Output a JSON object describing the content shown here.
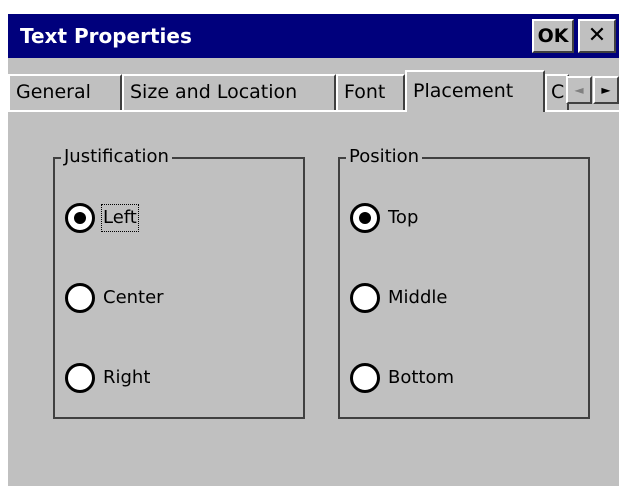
{
  "window": {
    "title": "Text Properties",
    "ok_label": "OK",
    "close_label": "✕"
  },
  "tabs": [
    {
      "label": "General",
      "selected": false
    },
    {
      "label": "Size and Location",
      "selected": false
    },
    {
      "label": "Font",
      "selected": false
    },
    {
      "label": "Placement",
      "selected": true
    },
    {
      "label": "C",
      "selected": false
    }
  ],
  "tab_scroll": {
    "left_icon": "◄",
    "right_icon": "►"
  },
  "justification": {
    "label": "Justification",
    "options": [
      {
        "label": "Left",
        "selected": true
      },
      {
        "label": "Center",
        "selected": false
      },
      {
        "label": "Right",
        "selected": false
      }
    ]
  },
  "position": {
    "label": "Position",
    "options": [
      {
        "label": "Top",
        "selected": true
      },
      {
        "label": "Middle",
        "selected": false
      },
      {
        "label": "Bottom",
        "selected": false
      }
    ]
  },
  "colors": {
    "titlebar": "#00007c",
    "face": "#c0c0c0"
  }
}
